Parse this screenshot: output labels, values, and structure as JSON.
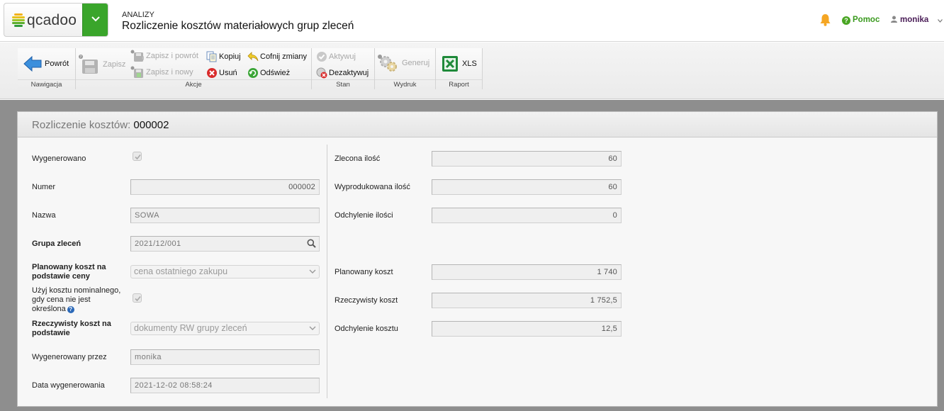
{
  "app": {
    "logo_text": "qcadoo",
    "section": "ANALIZY",
    "title": "Rozliczenie kosztów materiałowych grup zleceń",
    "help_label": "Pomoc",
    "user_name": "monika"
  },
  "ribbon": {
    "groups": {
      "nav": "Nawigacja",
      "actions": "Akcje",
      "state": "Stan",
      "print": "Wydruk",
      "report": "Raport"
    },
    "buttons": {
      "back": "Powrót",
      "save": "Zapisz",
      "save_back": "Zapisz i powrót",
      "save_new": "Zapisz i nowy",
      "copy": "Kopiuj",
      "delete": "Usuń",
      "undo": "Cofnij zmiany",
      "refresh": "Odśwież",
      "activate": "Aktywuj",
      "deactivate": "Dezaktywuj",
      "generate": "Generuj",
      "xls": "XLS"
    }
  },
  "panel": {
    "title_label": "Rozliczenie kosztów:",
    "title_number": "000002"
  },
  "form": {
    "generated_label": "Wygenerowano",
    "number_label": "Numer",
    "number_value": "000002",
    "name_label": "Nazwa",
    "name_value": "SOWA",
    "group_label": "Grupa zleceń",
    "group_value": "2021/12/001",
    "planned_basis_label": "Planowany koszt na podstawie ceny",
    "planned_basis_value": "cena ostatniego zakupu",
    "use_nominal_label": "Użyj kosztu nominalnego, gdy cena nie jest określona",
    "actual_basis_label": "Rzeczywisty koszt na podstawie",
    "actual_basis_value": "dokumenty RW grupy zleceń",
    "generated_by_label": "Wygenerowany przez",
    "generated_by_value": "monika",
    "generated_date_label": "Data wygenerowania",
    "generated_date_value": "2021-12-02 08:58:24",
    "ordered_qty_label": "Zlecona ilość",
    "ordered_qty_value": "60",
    "produced_qty_label": "Wyprodukowana ilość",
    "produced_qty_value": "60",
    "qty_deviation_label": "Odchylenie ilości",
    "qty_deviation_value": "0",
    "planned_cost_label": "Planowany koszt",
    "planned_cost_value": "1 740",
    "actual_cost_label": "Rzeczywisty koszt",
    "actual_cost_value": "1 752,5",
    "cost_deviation_label": "Odchylenie kosztu",
    "cost_deviation_value": "12,5"
  }
}
